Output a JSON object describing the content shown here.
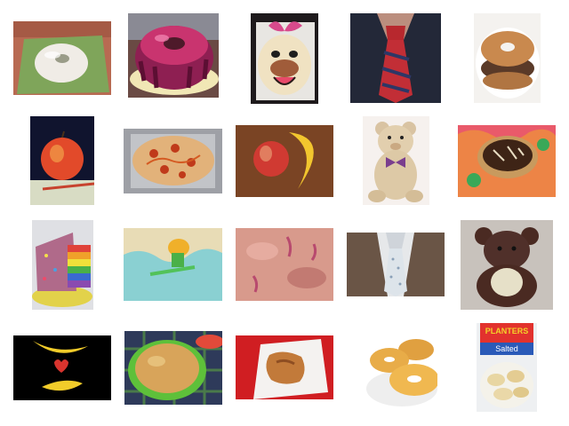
{
  "grid": {
    "background": "#ffffff",
    "rows": 4,
    "columns": 5
  },
  "thumbnails": [
    {
      "icon": "glazed-donut-icon"
    },
    {
      "icon": "bundt-cake-icon"
    },
    {
      "icon": "cartoon-face-cake-icon"
    },
    {
      "icon": "necktie-icon"
    },
    {
      "icon": "donut-sandwich-icon"
    },
    {
      "icon": "apple-icon"
    },
    {
      "icon": "pizza-icon"
    },
    {
      "icon": "apple-and-banana-icon"
    },
    {
      "icon": "teddy-bear-icon"
    },
    {
      "icon": "chocolate-pastry-icon"
    },
    {
      "icon": "rainbow-cake-icon"
    },
    {
      "icon": "frosted-cake-icon"
    },
    {
      "icon": "pink-cake-closeup-icon"
    },
    {
      "icon": "polka-dot-tie-icon"
    },
    {
      "icon": "knitted-bear-icon"
    },
    {
      "icon": "bananas-heart-icon"
    },
    {
      "icon": "upside-down-cake-icon"
    },
    {
      "icon": "pastry-on-napkin-icon"
    },
    {
      "icon": "glazed-donuts-icon"
    },
    {
      "icon": "banana-chips-icon"
    }
  ],
  "label_texts": {
    "can_label_line1": "PLANTERS",
    "can_label_line2": "Salted"
  }
}
